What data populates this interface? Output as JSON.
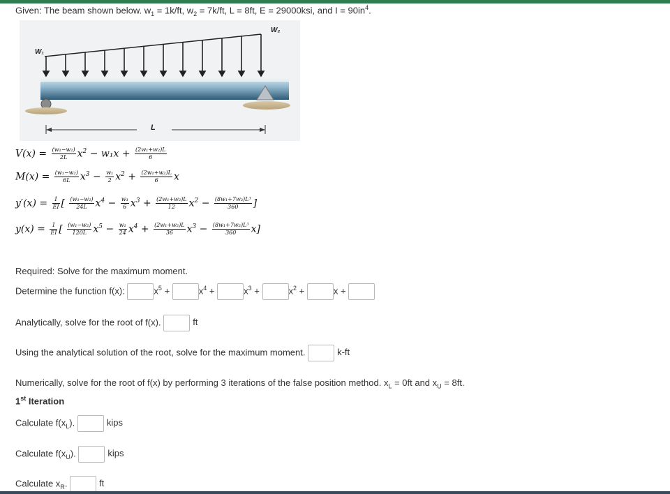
{
  "given": {
    "text_a": "Given: The beam shown below. w",
    "sub1": "1",
    "text_b": " = 1k/ft, w",
    "sub2": "2",
    "text_c": " = 7k/ft, L = 8ft, E = 29000ksi, and I = 90in",
    "sup4": "4",
    "text_d": "."
  },
  "figure": {
    "w1_label": "W₁",
    "w2_label": "W₂",
    "L_label": "L"
  },
  "equations": {
    "V": {
      "lhs": "V(x) =",
      "f1_num": "(w₁−w₂)",
      "f1_den": "2L",
      "t1": "x",
      "t1_exp": "2",
      "t2": "− w₁x +",
      "f2_num": "(2w₁+w₂)L",
      "f2_den": "6"
    },
    "M": {
      "lhs": "M(x) =",
      "f1_num": "(w₁−w₂)",
      "f1_den": "6L",
      "t1": "x",
      "t1_exp": "3",
      "t2": "−",
      "f2_num": "w₁",
      "f2_den": "2",
      "t3": "x",
      "t3_exp": "2",
      "t4": "+",
      "f3_num": "(2w₁+w₂)L",
      "f3_den": "6",
      "t5": "x"
    },
    "yp": {
      "lhs": "y′(x) =",
      "f0_num": "1",
      "f0_den": "EI",
      "open": "[",
      "f1_num": "(w₁−w₂)",
      "f1_den": "24L",
      "t1": "x",
      "t1_exp": "4",
      "t2": "−",
      "f2_num": "w₁",
      "f2_den": "6",
      "t3": "x",
      "t3_exp": "3",
      "t4": "+",
      "f3_num": "(2w₁+w₂)L",
      "f3_den": "12",
      "t5": "x",
      "t5_exp": "2",
      "t6": "−",
      "f4_num": "(8w₁+7w₂)L³",
      "f4_den": "360",
      "close": "]"
    },
    "y": {
      "lhs": "y(x) =",
      "f0_num": "1",
      "f0_den": "EI",
      "open": "[",
      "f1_num": "(w₁−w₂)",
      "f1_den": "120L",
      "t1": "x",
      "t1_exp": "5",
      "t2": "−",
      "f2_num": "w₁",
      "f2_den": "24",
      "t3": "x",
      "t3_exp": "4",
      "t4": "+",
      "f3_num": "(2w₁+w₂)L",
      "f3_den": "36",
      "t5": "x",
      "t5_exp": "3",
      "t6": "−",
      "f4_num": "(8w₁+7w₂)L³",
      "f4_den": "360",
      "t7": "x",
      "close": "]"
    }
  },
  "required": "Required: Solve for the maximum moment.",
  "function": {
    "label": "Determine the function f(x):",
    "x5": "x",
    "x5_exp": "5",
    "plus": "+",
    "x4": "x",
    "x4_exp": "4",
    "x3": "x",
    "x3_exp": "3",
    "x2": "x",
    "x2_exp": "2",
    "x1": "x +"
  },
  "root": {
    "label": "Analytically, solve for the root of f(x).",
    "unit": "ft"
  },
  "max_moment": {
    "label": "Using the analytical solution of the root, solve for the maximum moment.",
    "unit": "k-ft"
  },
  "numerical": {
    "text_a": "Numerically, solve for the root of f(x) by performing 3 iterations of the false position method. x",
    "sub_l": "L",
    "text_b": " = 0ft and x",
    "sub_u": "U",
    "text_c": " = 8ft."
  },
  "iteration": {
    "num": "1",
    "sup": "st",
    "word": " Iteration"
  },
  "calc_fl": {
    "a": "Calculate f(x",
    "sub": "L",
    "b": ").",
    "unit": "kips"
  },
  "calc_fu": {
    "a": "Calculate f(x",
    "sub": "U",
    "b": ").",
    "unit": "kips"
  },
  "calc_xr": {
    "a": "Calculate x",
    "sub": "R",
    "b": ".",
    "unit": "ft"
  }
}
